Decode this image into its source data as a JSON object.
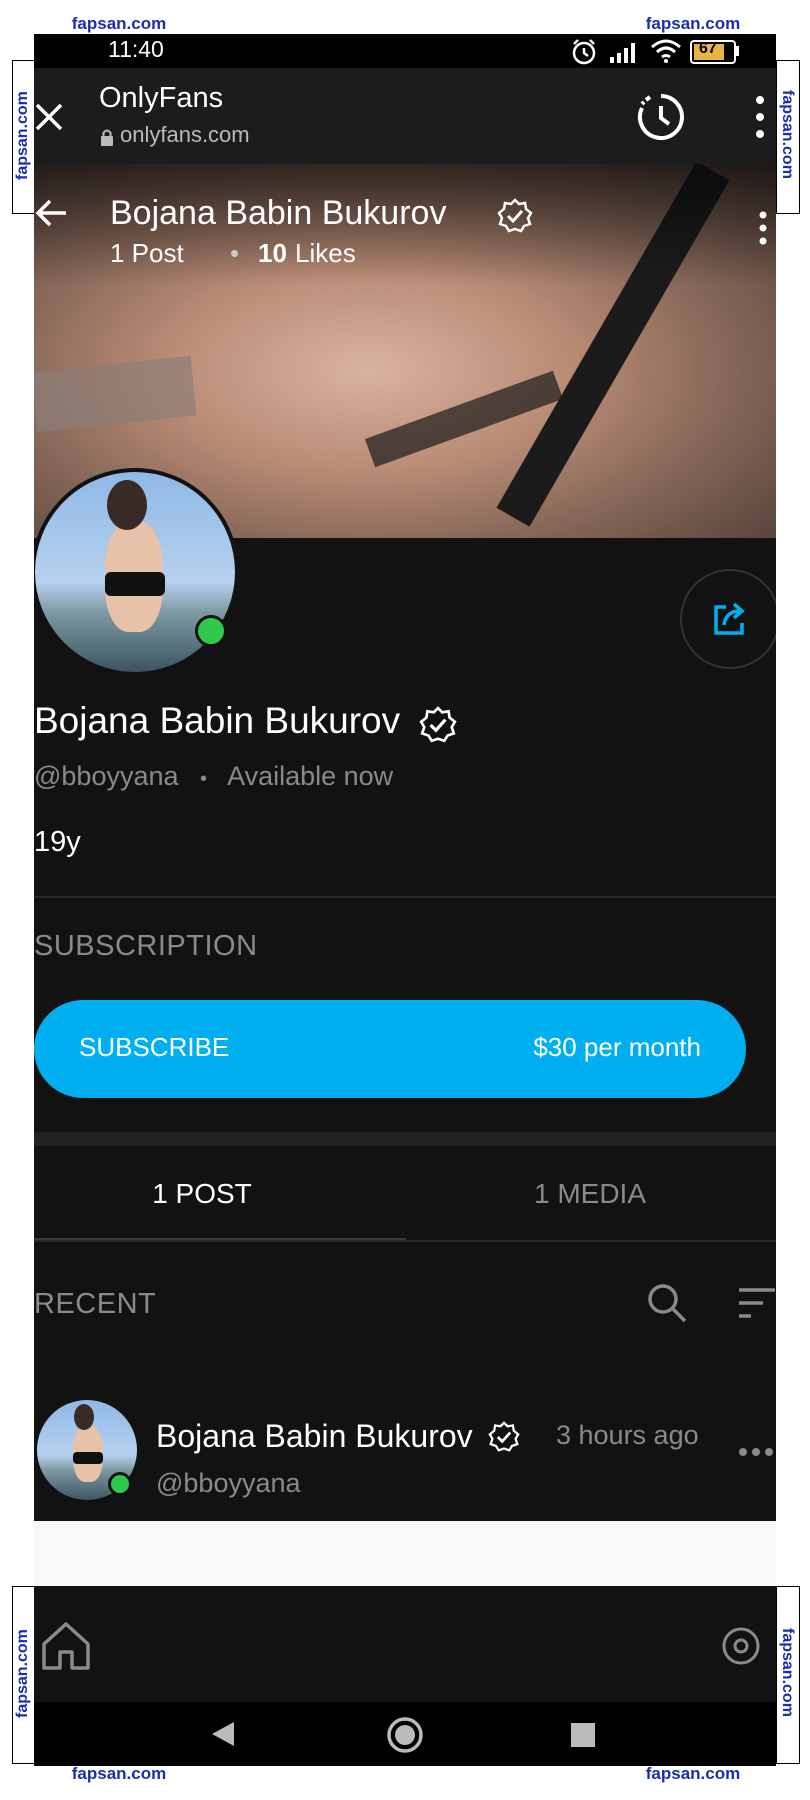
{
  "watermark": {
    "text": "fapsan.com"
  },
  "status": {
    "time": "11:40",
    "battery": "67"
  },
  "browser": {
    "title": "OnlyFans",
    "url": "onlyfans.com"
  },
  "header": {
    "name": "Bojana Babin Bukurov",
    "posts": "1 Post",
    "likes_count": "10",
    "likes_label": "Likes"
  },
  "profile": {
    "name": "Bojana Babin Bukurov",
    "handle": "@bboyyana",
    "availability": "Available now",
    "bio": "19y"
  },
  "subscription": {
    "section_label": "SUBSCRIPTION",
    "button_label": "SUBSCRIBE",
    "price": "$30 per month"
  },
  "tabs": [
    {
      "label": "1 POST",
      "active": true
    },
    {
      "label": "1 MEDIA",
      "active": false
    }
  ],
  "recent": {
    "label": "RECENT"
  },
  "post": {
    "name": "Bojana Babin Bukurov",
    "handle": "@bboyyana",
    "time": "3 hours ago"
  },
  "colors": {
    "accent": "#00aff0",
    "online": "#2fca4c",
    "background": "#121212"
  }
}
